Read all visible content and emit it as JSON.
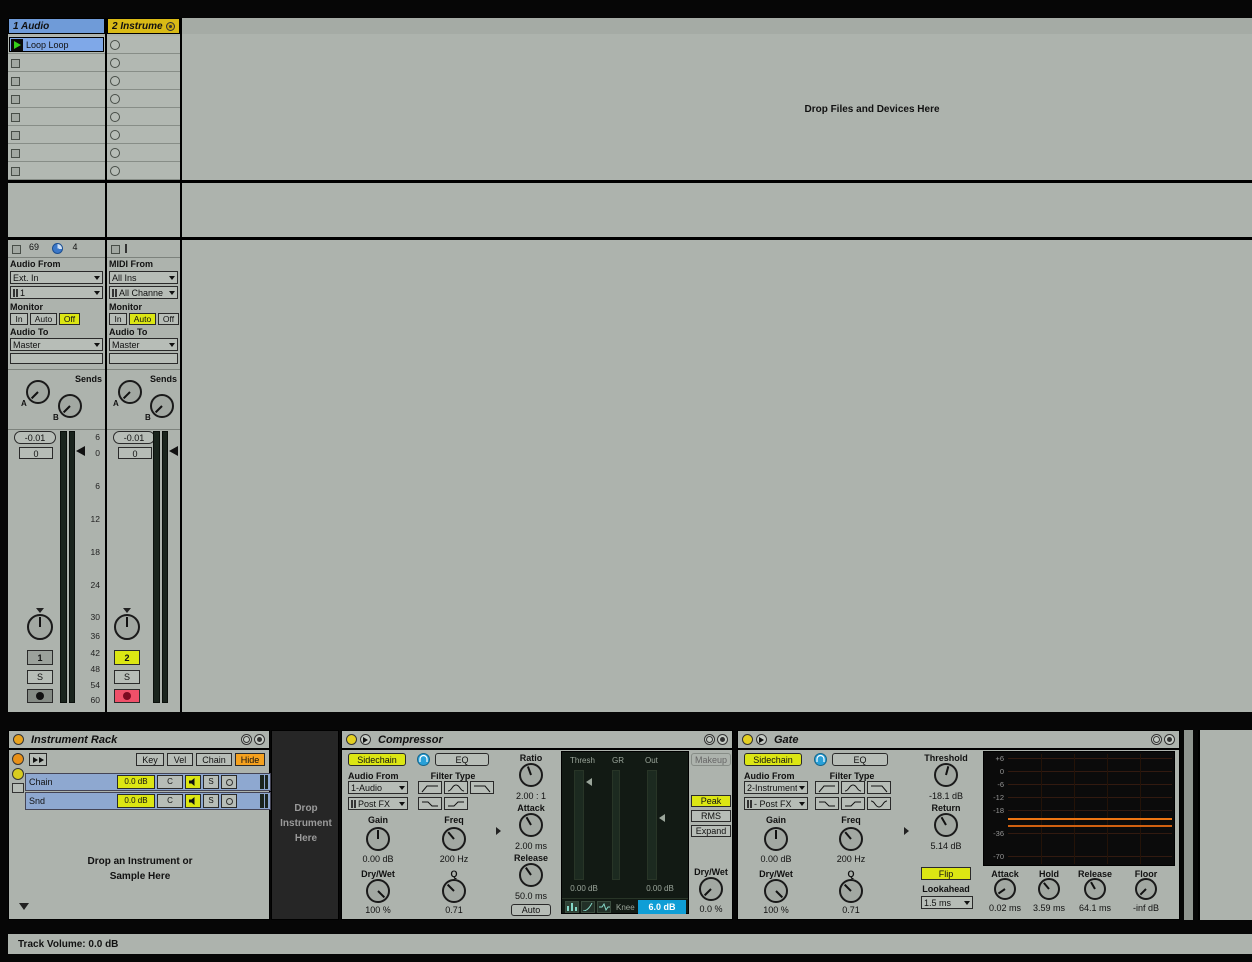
{
  "colors": {
    "track1_header": "#6f9bd8",
    "track2_header": "#d9ba16",
    "clip_blue": "#7fa8e8",
    "selected_yellow": "#dce613",
    "hide_orange": "#f5a11e",
    "record_armed_pink": "#ef5069",
    "knee_blue": "#0f9ed6",
    "gate_line_orange": "#ef7612"
  },
  "session": {
    "drop_hint": "Drop Files and Devices Here",
    "meter_scale": [
      "6",
      "0",
      "6",
      "12",
      "18",
      "24",
      "30",
      "36",
      "42",
      "48",
      "54",
      "60"
    ],
    "tracks": [
      {
        "header": "1 Audio",
        "clip_name": "Loop Loop",
        "status_count": "69",
        "status_beats": "4",
        "io": {
          "from_label": "Audio From",
          "from_value": "Ext. In",
          "channel_value": "1",
          "monitor_label": "Monitor",
          "monitor_in": "In",
          "monitor_auto": "Auto",
          "monitor_off": "Off",
          "to_label": "Audio To",
          "to_value": "Master"
        },
        "sends_label": "Sends",
        "send_a": "A",
        "send_b": "B",
        "volume": "-0.01",
        "delay": "0",
        "number": "1",
        "solo": "S"
      },
      {
        "header": "2 Instrume",
        "io": {
          "from_label": "MIDI From",
          "from_value": "All Ins",
          "channel_value": "All Channe",
          "monitor_label": "Monitor",
          "monitor_in": "In",
          "monitor_auto": "Auto",
          "monitor_off": "Off",
          "to_label": "Audio To",
          "to_value": "Master"
        },
        "sends_label": "Sends",
        "send_a": "A",
        "send_b": "B",
        "volume": "-0.01",
        "delay": "0",
        "number": "2",
        "solo": "S"
      }
    ]
  },
  "devices": {
    "instrument_rack": {
      "title": "Instrument Rack",
      "key": "Key",
      "vel": "Vel",
      "chain": "Chain",
      "hide": "Hide",
      "chains": [
        {
          "name": "Chain",
          "volume": "0.0 dB",
          "pan": "C",
          "solo": "S"
        },
        {
          "name": "Snd",
          "volume": "0.0 dB",
          "pan": "C",
          "solo": "S"
        }
      ],
      "drop_line1": "Drop an Instrument or",
      "drop_line2": "Sample Here"
    },
    "rack_drop_zone": {
      "line1": "Drop",
      "line2": "Instrument",
      "line3": "Here"
    },
    "compressor": {
      "title": "Compressor",
      "sidechain": "Sidechain",
      "eq": "EQ",
      "audio_from_label": "Audio From",
      "source": "1-Audio",
      "position": "Post FX",
      "filter_type_label": "Filter Type",
      "gain_label": "Gain",
      "gain_value": "0.00 dB",
      "freq_label": "Freq",
      "freq_value": "200 Hz",
      "drywet_label": "Dry/Wet",
      "drywet_value": "100 %",
      "q_label": "Q",
      "q_value": "0.71",
      "ratio_label": "Ratio",
      "ratio_value": "2.00 : 1",
      "attack_label": "Attack",
      "attack_value": "2.00 ms",
      "release_label": "Release",
      "release_value": "50.0 ms",
      "auto_label": "Auto",
      "meter": {
        "thresh_label": "Thresh",
        "gr_label": "GR",
        "out_label": "Out",
        "left_db": "0.00 dB",
        "right_db": "0.00 dB",
        "knee_label": "Knee",
        "knee_value": "6.0 dB"
      },
      "makeup": "Makeup",
      "peak": "Peak",
      "rms": "RMS",
      "expand": "Expand",
      "out_drywet_label": "Dry/Wet",
      "out_drywet_value": "0.0 %"
    },
    "gate": {
      "title": "Gate",
      "sidechain": "Sidechain",
      "eq": "EQ",
      "audio_from_label": "Audio From",
      "source": "2-Instrument",
      "position": "- Post FX",
      "filter_type_label": "Filter Type",
      "gain_label": "Gain",
      "gain_value": "0.00 dB",
      "freq_label": "Freq",
      "freq_value": "200 Hz",
      "drywet_label": "Dry/Wet",
      "drywet_value": "100 %",
      "q_label": "Q",
      "q_value": "0.71",
      "threshold_label": "Threshold",
      "threshold_value": "-18.1 dB",
      "return_label": "Return",
      "return_value": "5.14 dB",
      "flip": "Flip",
      "lookahead_label": "Lookahead",
      "lookahead_value": "1.5 ms",
      "scale": [
        "+6",
        "0",
        "-6",
        "-12",
        "-18",
        "-36",
        "-70"
      ],
      "attack_label": "Attack",
      "attack_value": "0.02 ms",
      "hold_label": "Hold",
      "hold_value": "3.59 ms",
      "release_label": "Release",
      "release_value": "64.1 ms",
      "floor_label": "Floor",
      "floor_value": "-inf dB"
    }
  },
  "status_bar": {
    "text": "Track Volume: 0.0 dB"
  }
}
